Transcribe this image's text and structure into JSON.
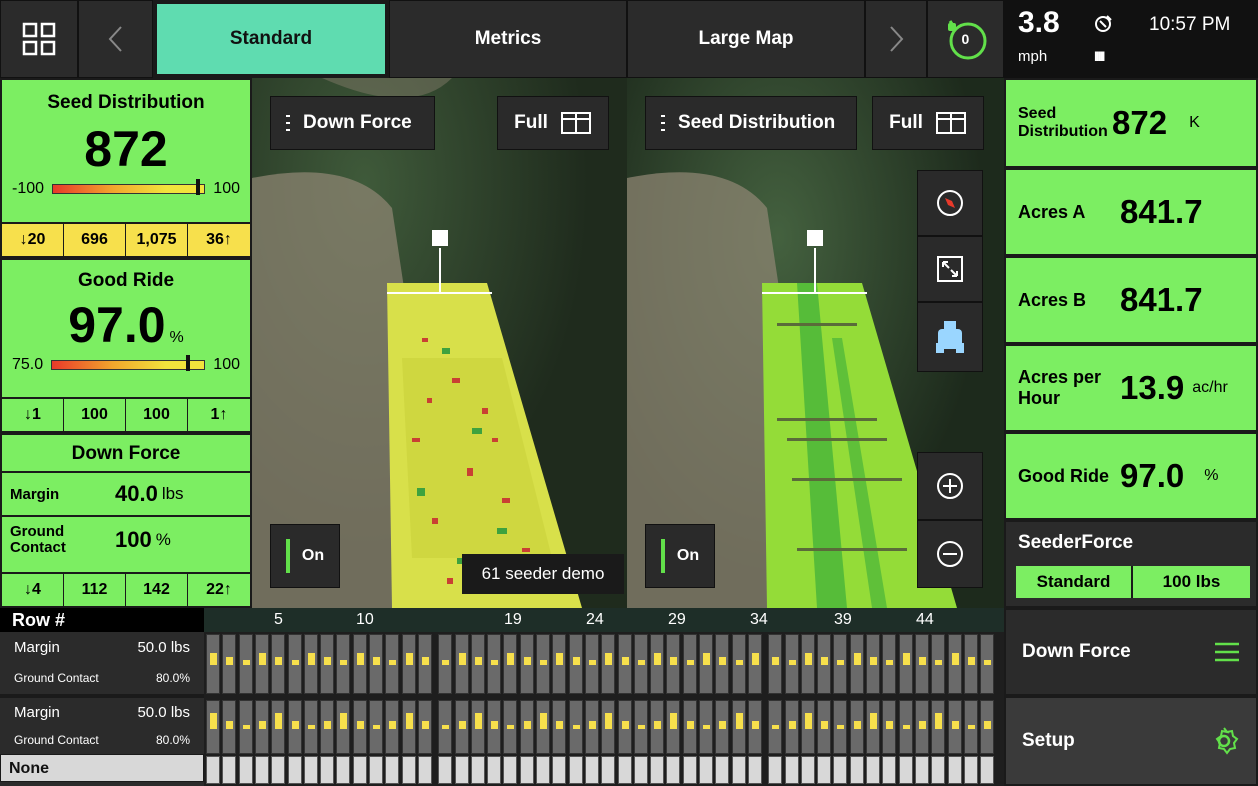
{
  "topbar": {
    "tabs": [
      "Standard",
      "Metrics",
      "Large Map"
    ],
    "active_tab": "Standard",
    "alert_count": "0"
  },
  "status": {
    "speed": "3.8",
    "speed_unit": "mph",
    "time": "10:57 PM",
    "signal": "IIIII"
  },
  "left": {
    "seed": {
      "title": "Seed Distribution",
      "value": "872",
      "min": "-100",
      "max": "100",
      "low_count": "20",
      "low_val": "696",
      "high_val": "1,075",
      "high_count": "36"
    },
    "ride": {
      "title": "Good Ride",
      "value": "97.0",
      "unit": "%",
      "min": "75.0",
      "max": "100",
      "low_count": "1",
      "low_val": "100",
      "high_val": "100",
      "high_count": "1"
    },
    "force": {
      "title": "Down Force",
      "margin_label": "Margin",
      "margin_value": "40.0",
      "margin_unit": "lbs",
      "contact_label": "Ground Contact",
      "contact_value": "100",
      "contact_unit": "%",
      "low_count": "4",
      "low_val": "112",
      "high_val": "142",
      "high_count": "22"
    }
  },
  "maps": {
    "left_layer": "Down Force",
    "right_layer": "Seed Distribution",
    "full_label": "Full",
    "on_label": "On",
    "caption": "61 seeder demo"
  },
  "right": {
    "seed_label": "Seed Distribution",
    "seed_value": "872",
    "seed_unit": "K",
    "acres_a_label": "Acres A",
    "acres_a_value": "841.7",
    "acres_b_label": "Acres B",
    "acres_b_value": "841.7",
    "aph_label": "Acres per Hour",
    "aph_value": "13.9",
    "aph_unit": "ac/hr",
    "ride_label": "Good Ride",
    "ride_value": "97.0",
    "ride_unit": "%",
    "seederforce_title": "SeederForce",
    "seederforce_mode": "Standard",
    "seederforce_value": "100 lbs",
    "downforce_label": "Down Force",
    "setup_label": "Setup"
  },
  "rows": {
    "header": "Row #",
    "numbers": [
      "5",
      "10",
      "19",
      "24",
      "29",
      "34",
      "39",
      "44"
    ],
    "margin_label": "Margin",
    "margin_value": "50.0 lbs",
    "contact_label": "Ground Contact",
    "contact_value": "80.0%",
    "margin2_label": "Margin",
    "margin2_value": "50.0 lbs",
    "contact2_label": "Ground Contact",
    "contact2_value": "80.0%",
    "none_label": "None"
  },
  "colors": {
    "accent_green": "#7cee62",
    "active_tab": "#5fdcb0",
    "warning_yellow": "#f7e04c",
    "dark": "#2b2b2b"
  },
  "icons": [
    "grid-icon",
    "chevron-left-icon",
    "chevron-right-icon",
    "bell-icon",
    "satellite-icon",
    "compass-icon",
    "expand-icon",
    "tractor-icon",
    "zoom-in-icon",
    "zoom-out-icon",
    "menu-icon",
    "gear-icon",
    "split-view-icon"
  ]
}
